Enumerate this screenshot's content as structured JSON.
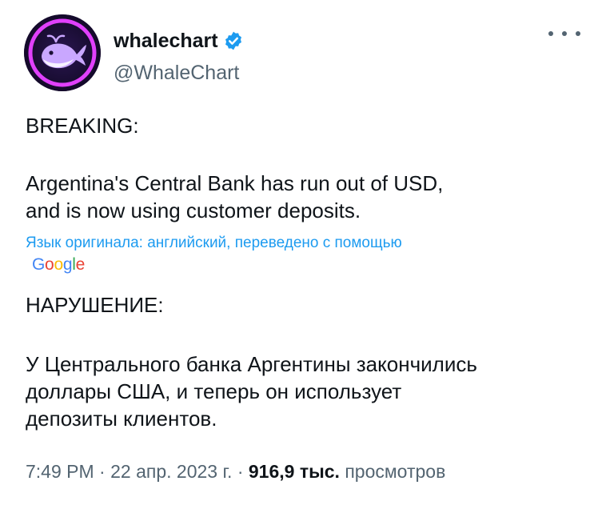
{
  "author": {
    "display_name": "whalechart",
    "handle": "@WhaleChart",
    "verified": true,
    "avatar_icon": "whale-icon",
    "avatar_colors": {
      "background": "#1b1036",
      "ring": "#e040fb",
      "whale": "#c9a7ff"
    }
  },
  "menu": {
    "icon": "more-options-icon"
  },
  "original": {
    "heading": "BREAKING:",
    "body": "Argentina's Central Bank has run out of USD,\nand is now using customer deposits."
  },
  "translation": {
    "note": "Язык оригинала: английский, переведено с помощью",
    "provider": "Google",
    "heading": "НАРУШЕНИЕ:",
    "body": "У Центрального банка Аргентины закончились\nдоллары США, и теперь он использует\nдепозиты клиентов."
  },
  "meta": {
    "time": "7:49 PM",
    "date": "22 апр. 2023 г.",
    "views_count": "916,9 тыс.",
    "views_label": "просмотров"
  },
  "colors": {
    "text": "#0f1419",
    "secondary": "#536471",
    "link": "#1d9bf0",
    "verified": "#1d9bf0"
  }
}
